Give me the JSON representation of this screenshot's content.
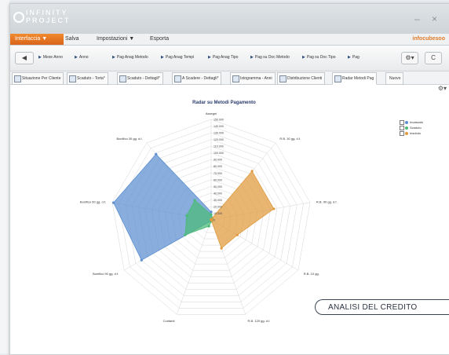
{
  "app": {
    "logo_line1": "INFINITY",
    "logo_line2": "PROJECT",
    "brand": "infocubesoo",
    "window_controls": "– ×"
  },
  "menu": [
    "Interfaccia ▼",
    "Salva",
    "Impostazioni ▼",
    "Esporta"
  ],
  "toolbar": {
    "back": "◀",
    "forward": "C",
    "settings": "⚙▾",
    "items": [
      "Mese Anno",
      "Anno",
      "Pag Anag Metodo",
      "Pag Anag Tempi",
      "Pag Anag Tipo",
      "Pag su Doc Metodo",
      "Pag su Doc Tipo",
      "Pag"
    ]
  },
  "tabs": [
    "Situazione Per Cliente",
    "Scaduto - Torta*",
    "Scaduto - Dettagli*",
    "A Scadere - Dettagli*",
    "Istogramma - Anni",
    "Distribuzione Clienti",
    "Radar Metodi Pag",
    "Nuovo"
  ],
  "content": {
    "gear": "⚙▾"
  },
  "badge": "ANALISI DEL CREDITO",
  "chart_data": {
    "type": "radar",
    "title": "Radar su Metodi Pagamento",
    "categories": [
      "Assegni",
      "R.B. 30 gg. d.f.",
      "R.B. 90 gg. d.f.",
      "R.B. 10 gg.",
      "R.B. 120 gg. d.f.",
      "Contanti",
      "Bonifico 90 gg. d.f.",
      "Bonifico 60 gg. d.f.",
      "Bonifico 30 gg. d.f."
    ],
    "ticks": [
      "0",
      "10.000",
      "20.000",
      "30.000",
      "40.000",
      "50.000",
      "60.000",
      "70.000",
      "80.000",
      "90.000",
      "100.000",
      "110.000",
      "120.000",
      "130.000",
      "140.000",
      "150.000"
    ],
    "rmax": 150000,
    "series": [
      {
        "name": "Incassato",
        "color": "#5b8fd1",
        "values": [
          12000,
          3000,
          2000,
          1000,
          0,
          2000,
          120000,
          148000,
          128000
        ]
      },
      {
        "name": "Scaduto",
        "color": "#4bbb77",
        "values": [
          8000,
          3000,
          2000,
          1000,
          2000,
          10000,
          45000,
          37000,
          38000
        ]
      },
      {
        "name": "Insoluto",
        "color": "#e09a3c",
        "values": [
          1000,
          95000,
          95000,
          45000,
          45000,
          0,
          0,
          0,
          0
        ]
      }
    ],
    "legend_position": "top-right"
  }
}
